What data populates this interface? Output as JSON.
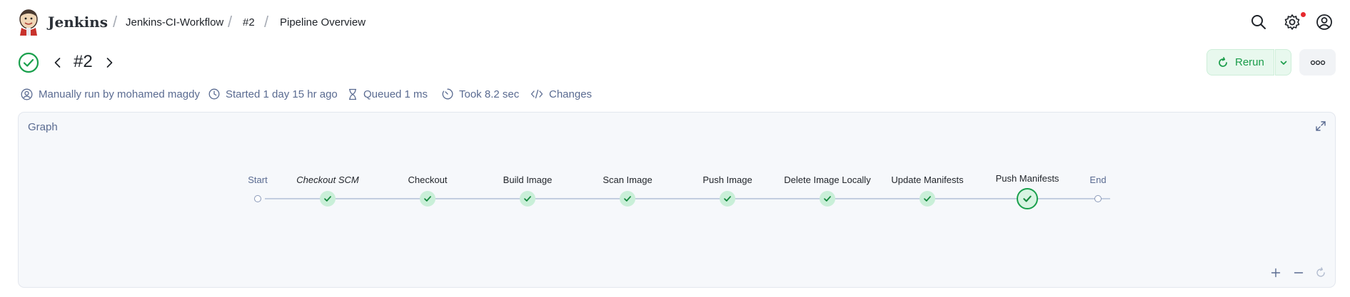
{
  "header": {
    "brand": "Jenkins",
    "breadcrumbs": [
      {
        "label": "Jenkins-CI-Workflow"
      },
      {
        "label": "#2"
      },
      {
        "label": "Pipeline Overview"
      }
    ],
    "icons": [
      "search-icon",
      "settings-icon",
      "account-icon"
    ],
    "notification_color": "#e6292e"
  },
  "build": {
    "status": "success",
    "number": "#2",
    "rerun_label": "Rerun",
    "accent_color": "#1a9c4a"
  },
  "meta": {
    "run_by": "Manually run by mohamed magdy",
    "started": "Started 1 day 15 hr ago",
    "queued": "Queued 1 ms",
    "took": "Took 8.2 sec",
    "changes": "Changes"
  },
  "graph": {
    "title": "Graph",
    "start_label": "Start",
    "end_label": "End",
    "stages": [
      {
        "label": "Checkout SCM",
        "status": "success"
      },
      {
        "label": "Checkout",
        "status": "success"
      },
      {
        "label": "Build Image",
        "status": "success"
      },
      {
        "label": "Scan Image",
        "status": "success"
      },
      {
        "label": "Push Image",
        "status": "success"
      },
      {
        "label": "Delete Image Locally",
        "status": "success"
      },
      {
        "label": "Update Manifests",
        "status": "success"
      },
      {
        "label": "Push Manifests",
        "status": "success",
        "selected": true
      }
    ]
  }
}
